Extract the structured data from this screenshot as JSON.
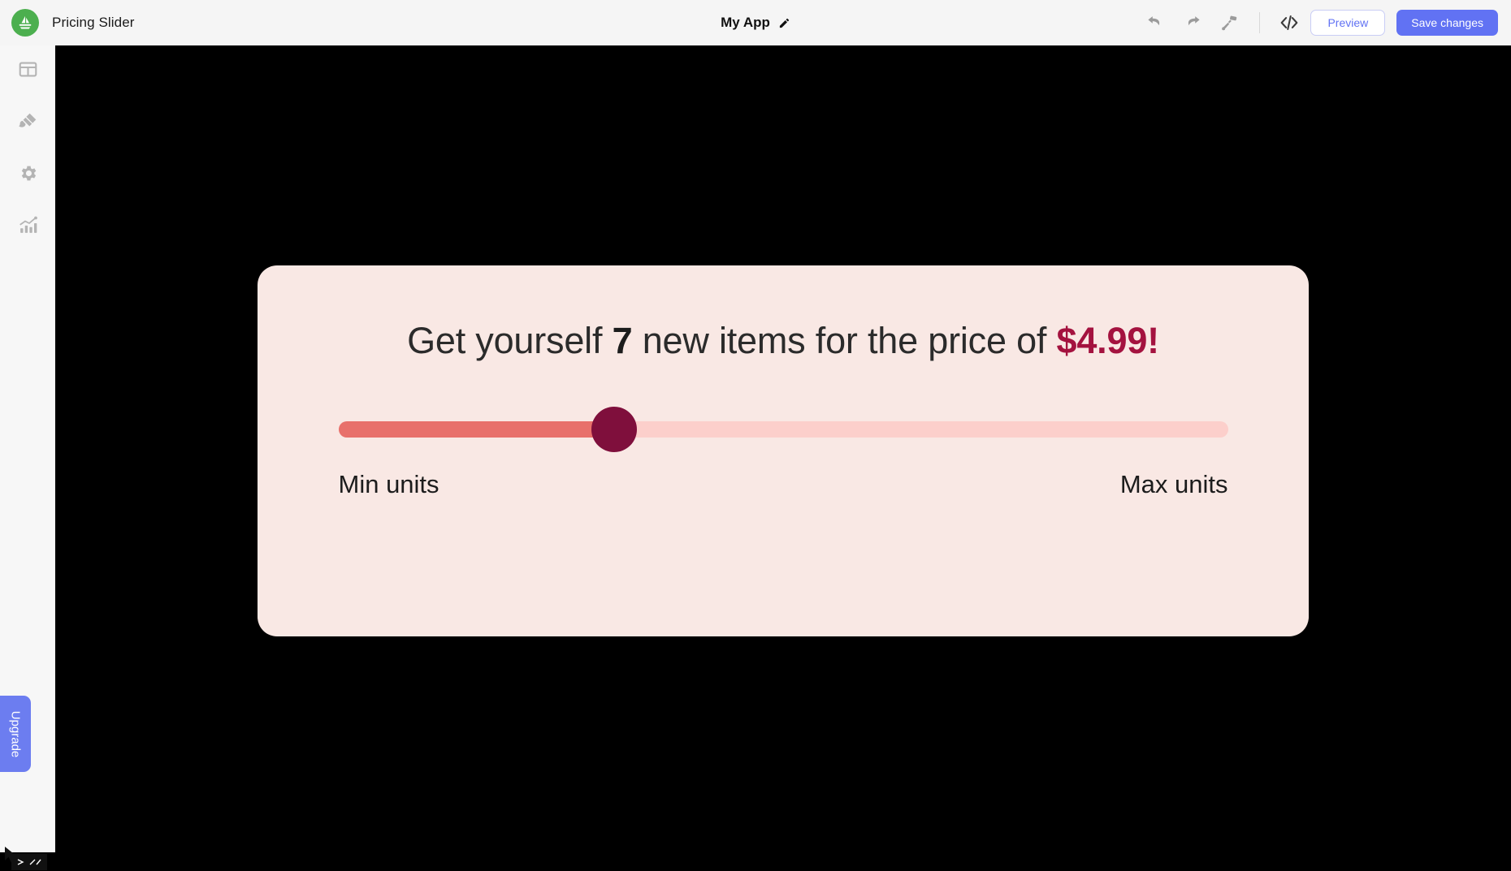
{
  "header": {
    "app_name": "Pricing Slider",
    "logo_icon": "sailboat-logo-icon",
    "logo_color": "#4CAF4F",
    "project_title": "My App",
    "edit_icon": "pencil-icon",
    "tools": [
      {
        "name": "undo-icon",
        "label": "Undo"
      },
      {
        "name": "redo-icon",
        "label": "Redo"
      },
      {
        "name": "paint-roller-icon",
        "label": "Theme"
      }
    ],
    "code_icon": "code-brackets-icon",
    "preview_label": "Preview",
    "save_label": "Save changes",
    "accent_color": "#6172F3"
  },
  "sidebar": {
    "items": [
      {
        "name": "sidebar-item-layout",
        "icon": "table-layout-icon"
      },
      {
        "name": "sidebar-item-design",
        "icon": "paint-brush-icon"
      },
      {
        "name": "sidebar-item-settings",
        "icon": "gear-icon"
      },
      {
        "name": "sidebar-item-analytics",
        "icon": "analytics-chart-icon"
      }
    ],
    "upgrade_label": "Upgrade",
    "upgrade_color": "#6C7DF0",
    "cursor_icon": "mouse-cursor-icon"
  },
  "canvas": {
    "background_color": "#000000",
    "card": {
      "background_color": "#F9E8E4",
      "headline_prefix": "Get yourself ",
      "headline_units": "7",
      "headline_middle": " new items for the price of ",
      "headline_price": "$4.99!",
      "price_color": "#A4123F",
      "slider": {
        "name": "pricing-slider",
        "value": 7,
        "percent": 31,
        "track_color": "#FCCFCB",
        "fill_color": "#E8706B",
        "thumb_color": "#7F0F3C",
        "min_label": "Min units",
        "max_label": "Max units"
      }
    }
  }
}
